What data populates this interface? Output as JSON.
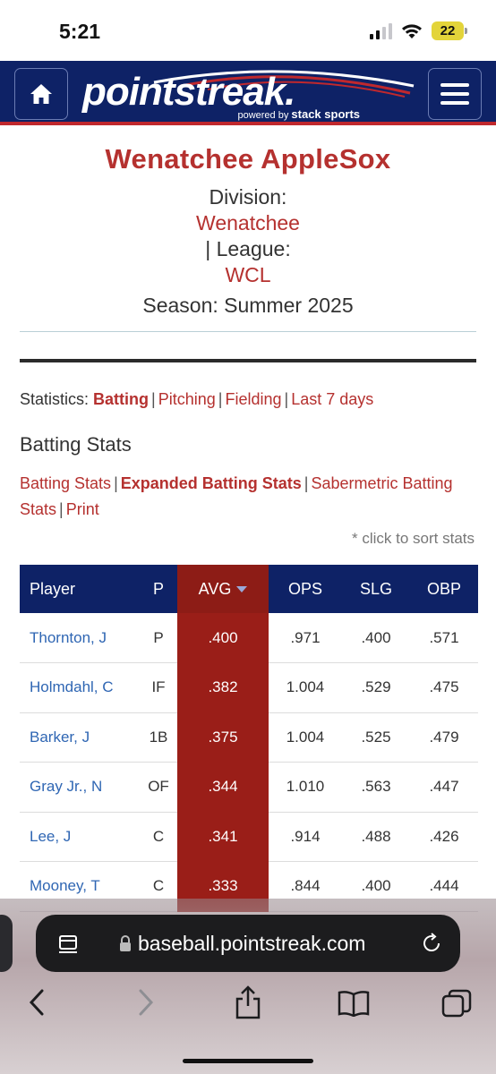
{
  "status_bar": {
    "time": "5:21",
    "battery": "22"
  },
  "header": {
    "logo_text": "pointstreak.",
    "powered_by": "powered by",
    "sponsor": "stack sports"
  },
  "team": {
    "name": "Wenatchee AppleSox",
    "division_label": "Division:",
    "division_value": "Wenatchee",
    "league_label": "| League:",
    "league_value": "WCL",
    "season": "Season: Summer 2025"
  },
  "stat_nav": {
    "prefix": "Statistics:",
    "items": [
      "Batting",
      "Pitching",
      "Fielding",
      "Last 7 days"
    ]
  },
  "section_title": "Batting Stats",
  "sub_nav": {
    "items": [
      "Batting Stats",
      "Expanded Batting Stats",
      "Sabermetric Batting Stats",
      "Print"
    ]
  },
  "sort_note": "* click to sort stats",
  "table": {
    "headers": [
      "Player",
      "P",
      "AVG",
      "OPS",
      "SLG",
      "OBP"
    ],
    "rows": [
      {
        "player": "Thornton, J",
        "pos": "P",
        "avg": ".400",
        "ops": ".971",
        "slg": ".400",
        "obp": ".571"
      },
      {
        "player": "Holmdahl, C",
        "pos": "IF",
        "avg": ".382",
        "ops": "1.004",
        "slg": ".529",
        "obp": ".475"
      },
      {
        "player": "Barker, J",
        "pos": "1B",
        "avg": ".375",
        "ops": "1.004",
        "slg": ".525",
        "obp": ".479"
      },
      {
        "player": "Gray Jr., N",
        "pos": "OF",
        "avg": ".344",
        "ops": "1.010",
        "slg": ".563",
        "obp": ".447"
      },
      {
        "player": "Lee, J",
        "pos": "C",
        "avg": ".341",
        "ops": ".914",
        "slg": ".488",
        "obp": ".426"
      },
      {
        "player": "Mooney, T",
        "pos": "C",
        "avg": ".333",
        "ops": ".844",
        "slg": ".400",
        "obp": ".444"
      }
    ]
  },
  "browser": {
    "url": "baseball.pointstreak.com"
  },
  "colors": {
    "navy": "#0e2266",
    "red_text": "#b5312f",
    "avg_column": "#9a1e18",
    "link_blue": "#2f66b3"
  }
}
